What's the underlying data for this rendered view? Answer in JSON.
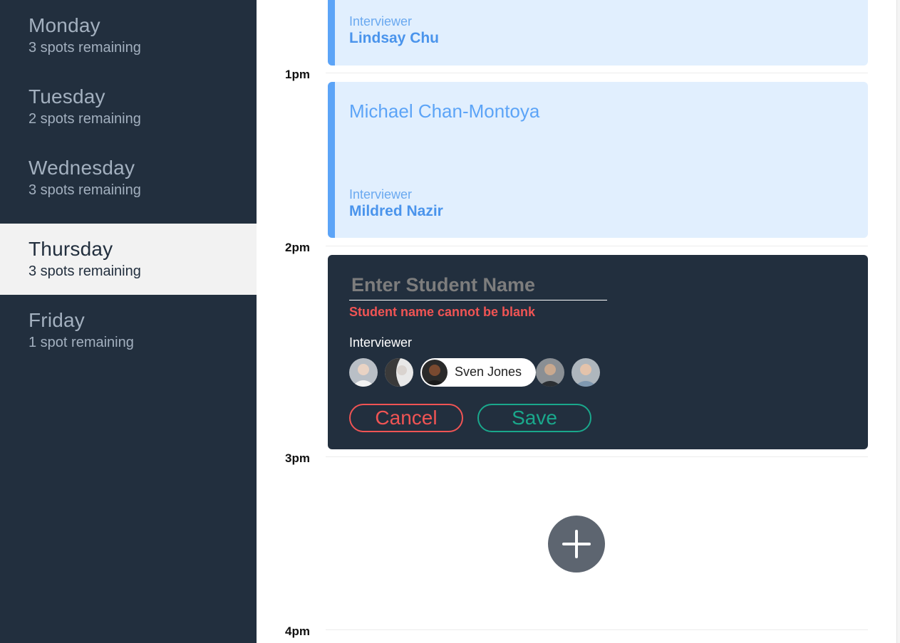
{
  "sidebar": {
    "days": [
      {
        "name": "Monday",
        "spots": "3 spots remaining"
      },
      {
        "name": "Tuesday",
        "spots": "2 spots remaining"
      },
      {
        "name": "Wednesday",
        "spots": "3 spots remaining"
      },
      {
        "name": "Thursday",
        "spots": "3 spots remaining",
        "selected": true
      },
      {
        "name": "Friday",
        "spots": "1 spot remaining"
      }
    ]
  },
  "schedule": {
    "times": [
      "1pm",
      "2pm",
      "3pm",
      "4pm"
    ],
    "appointments": [
      {
        "student": "",
        "interviewer_label": "Interviewer",
        "interviewer": "Lindsay Chu"
      },
      {
        "student": "Michael Chan-Montoya",
        "interviewer_label": "Interviewer",
        "interviewer": "Mildred Nazir"
      }
    ],
    "form": {
      "placeholder": "Enter Student Name",
      "error": "Student name cannot be blank",
      "interviewer_label": "Interviewer",
      "selected_interviewer": "Sven Jones",
      "cancel": "Cancel",
      "save": "Save"
    }
  },
  "colors": {
    "sidebar_bg": "#222f3e",
    "accent_blue": "#5ca4f7",
    "danger": "#f05454",
    "success": "#1aa88c"
  },
  "icons": {
    "add": "plus-icon"
  }
}
